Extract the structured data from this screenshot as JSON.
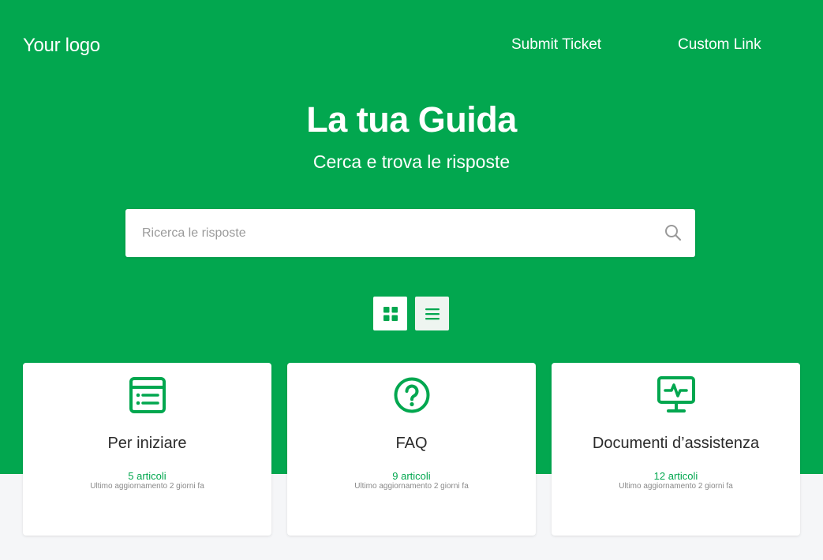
{
  "header": {
    "logo": "Your logo",
    "nav": [
      {
        "label": "Submit Ticket"
      },
      {
        "label": "Custom Link"
      }
    ]
  },
  "hero": {
    "title": "La tua Guida",
    "subtitle": "Cerca e trova le risposte"
  },
  "search": {
    "placeholder": "Ricerca le risposte",
    "value": "",
    "icon": "search-icon"
  },
  "view_toggle": {
    "options": [
      {
        "icon": "grid-icon",
        "selected": true
      },
      {
        "icon": "list-icon",
        "selected": false
      }
    ]
  },
  "categories": [
    {
      "title": "Per iniziare",
      "count": "5 articoli",
      "updated": "Ultimo aggiornamento 2 giorni fa",
      "icon": "list-document-icon"
    },
    {
      "title": "FAQ",
      "count": "9 articoli",
      "updated": "Ultimo aggiornamento 2 giorni fa",
      "icon": "question-circle-icon"
    },
    {
      "title": "Documenti d’assistenza",
      "count": "12 articoli",
      "updated": "Ultimo aggiornamento 2 giorni fa",
      "icon": "monitor-pulse-icon"
    }
  ],
  "colors": {
    "brand": "#02a74f",
    "background": "#f5f6f8",
    "card": "#ffffff",
    "text": "#2b2b2b",
    "muted": "#8a8a8a"
  }
}
